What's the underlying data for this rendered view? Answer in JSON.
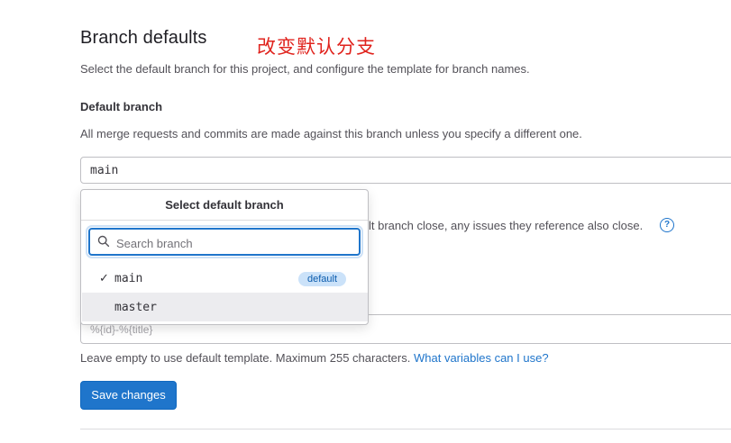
{
  "section": {
    "title": "Branch defaults",
    "annotation": "改变默认分支",
    "description": "Select the default branch for this project, and configure the template for branch names."
  },
  "default_branch": {
    "label": "Default branch",
    "help": "All merge requests and commits are made against this branch unless you specify a different one.",
    "value": "main"
  },
  "dropdown": {
    "header": "Select default branch",
    "search_placeholder": "Search branch",
    "items": [
      {
        "label": "main",
        "checked": true,
        "badge": "default"
      },
      {
        "label": "master",
        "checked": false,
        "badge": ""
      }
    ]
  },
  "obscured": {
    "auto_close_text": "lt branch close, any issues they reference also close.",
    "help_icon": "question-circle-icon"
  },
  "template": {
    "placeholder": "%{id}-%{title}",
    "help": "Leave empty to use default template. Maximum 255 characters.",
    "help_link": "What variables can I use?"
  },
  "save_button": "Save changes",
  "colors": {
    "primary": "#1f75cb",
    "annotation": "#e0231d",
    "badge_bg": "#cbe2f9",
    "hover_bg": "#ececef"
  }
}
